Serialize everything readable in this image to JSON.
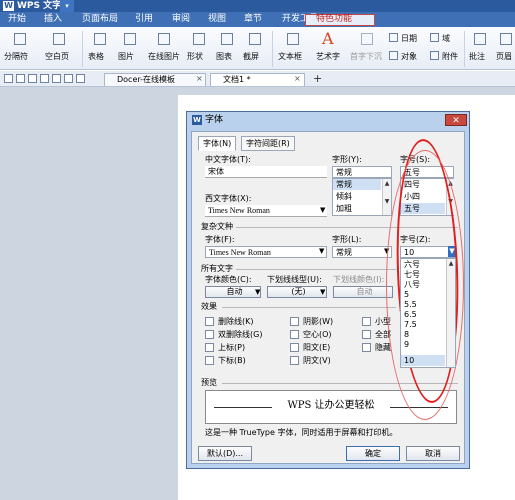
{
  "app": {
    "logo": "W",
    "title": "WPS 文字",
    "menu_arrow": "▾"
  },
  "menu": [
    "开始",
    "插入",
    "页面布局",
    "引用",
    "审阅",
    "视图",
    "章节",
    "开发工具",
    "特色功能"
  ],
  "ribbon": {
    "page_break": "分隔符",
    "blank_page": "空白页",
    "table": "表格",
    "picture": "图片",
    "online_picture": "在线图片",
    "shapes": "形状",
    "chart": "图表",
    "screenshot": "截屏",
    "textbox": "文本框",
    "wordart": "艺术字",
    "drop_cap": "首字下沉",
    "date": "日期",
    "field": "域",
    "object": "对象",
    "attachment": "附件",
    "comment": "批注",
    "more": "页眉"
  },
  "tabs": {
    "template": "Docer-在线模板",
    "document": "文档1 *",
    "close": "×",
    "add": "+"
  },
  "dialog": {
    "title": "字体",
    "close": "✕",
    "tab_font": "字体(N)",
    "tab_spacing": "字符间距(R)",
    "cn_font_label": "中文字体(T):",
    "cn_font_value": "宋体",
    "style_label": "字形(Y):",
    "style_value": "常规",
    "styles": [
      "常规",
      "倾斜",
      "加粗"
    ],
    "size_label": "字号(S):",
    "size_value": "五号",
    "sizes": [
      "四号",
      "小四",
      "五号"
    ],
    "west_font_label": "西文字体(X):",
    "west_font_value": "Times New Roman",
    "complex_section": "复杂文种",
    "complex_font_label": "字体(F):",
    "complex_font_value": "Times New Roman",
    "complex_style_label": "字形(L):",
    "complex_style_value": "常规",
    "complex_size_label": "字号(Z):",
    "complex_size_value": "10",
    "complex_sizes": [
      "六号",
      "七号",
      "八号",
      "5",
      "5.5",
      "6.5",
      "7.5",
      "8",
      "9",
      "10"
    ],
    "all_text_section": "所有文字",
    "color_label": "字体颜色(C):",
    "color_value": "自动",
    "underline_label": "下划线线型(U):",
    "underline_value": "(无)",
    "underline_color_label": "下划线颜色(I):",
    "underline_color_value": "自动",
    "effects_section": "效果",
    "effects_col1": [
      "删除线(K)",
      "双删除线(G)",
      "上标(P)",
      "下标(B)"
    ],
    "effects_col2": [
      "阴影(W)",
      "空心(O)",
      "阳文(E)",
      "阴文(V)"
    ],
    "effects_col3": [
      "小型",
      "全部",
      "隐藏"
    ],
    "preview_section": "预览",
    "preview_text": "WPS 让办公更轻松",
    "preview_note": "这是一种 TrueType 字体，同时适用于屏幕和打印机。",
    "default_button": "默认(D)...",
    "ok_button": "确定",
    "cancel_button": "取消"
  }
}
